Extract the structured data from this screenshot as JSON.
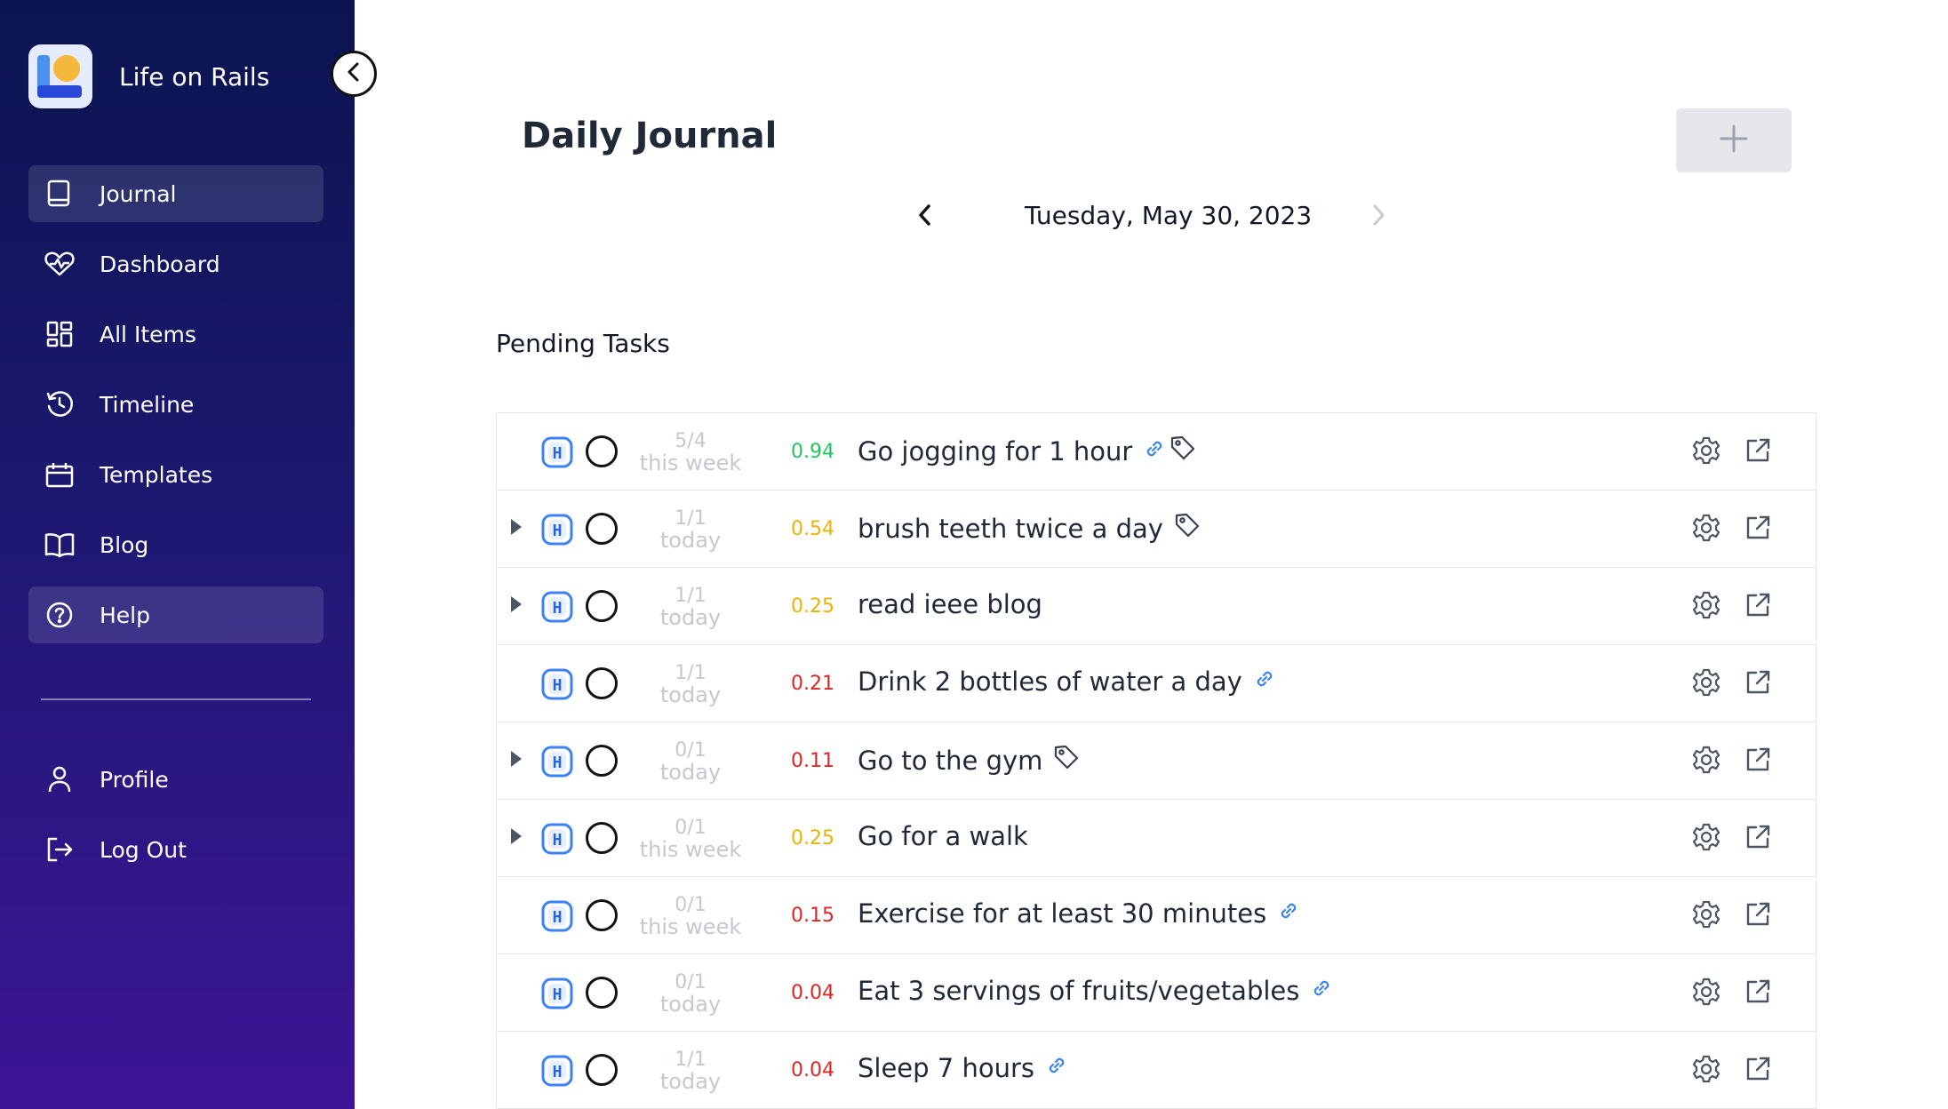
{
  "app": {
    "name": "Life on Rails"
  },
  "sidebar": {
    "items": [
      {
        "label": "Journal",
        "icon": "book-icon",
        "active": true
      },
      {
        "label": "Dashboard",
        "icon": "heart-pulse-icon"
      },
      {
        "label": "All Items",
        "icon": "grid-icon"
      },
      {
        "label": "Timeline",
        "icon": "history-icon"
      },
      {
        "label": "Templates",
        "icon": "calendar-icon"
      },
      {
        "label": "Blog",
        "icon": "open-book-icon"
      },
      {
        "label": "Help",
        "icon": "help-circle-icon",
        "active": true
      }
    ],
    "bottom_items": [
      {
        "label": "Profile",
        "icon": "user-icon"
      },
      {
        "label": "Log Out",
        "icon": "logout-icon"
      }
    ]
  },
  "page": {
    "title": "Daily Journal",
    "add_label": "+"
  },
  "date_nav": {
    "date": "Tuesday, May 30, 2023"
  },
  "pending": {
    "title": "Pending Tasks"
  },
  "tasks": [
    {
      "progress": "5/4",
      "period": "this week",
      "score": "0.94",
      "score_color": "#22c55e",
      "title": "Go jogging for 1 hour",
      "expandable": false,
      "link": true,
      "tag": true
    },
    {
      "progress": "1/1",
      "period": "today",
      "score": "0.54",
      "score_color": "#eab308",
      "title": "brush teeth twice a day",
      "expandable": true,
      "link": false,
      "tag": true
    },
    {
      "progress": "1/1",
      "period": "today",
      "score": "0.25",
      "score_color": "#eab308",
      "title": "read ieee blog",
      "expandable": true,
      "link": false,
      "tag": false
    },
    {
      "progress": "1/1",
      "period": "today",
      "score": "0.21",
      "score_color": "#dc2626",
      "title": "Drink 2 bottles of water a day",
      "expandable": false,
      "link": true,
      "tag": false
    },
    {
      "progress": "0/1",
      "period": "today",
      "score": "0.11",
      "score_color": "#dc2626",
      "title": "Go to the gym",
      "expandable": true,
      "link": false,
      "tag": true
    },
    {
      "progress": "0/1",
      "period": "this week",
      "score": "0.25",
      "score_color": "#eab308",
      "title": "Go for a walk",
      "expandable": true,
      "link": false,
      "tag": false
    },
    {
      "progress": "0/1",
      "period": "this week",
      "score": "0.15",
      "score_color": "#dc2626",
      "title": "Exercise for at least 30 minutes",
      "expandable": false,
      "link": true,
      "tag": false
    },
    {
      "progress": "0/1",
      "period": "today",
      "score": "0.04",
      "score_color": "#dc2626",
      "title": "Eat 3 servings of fruits/vegetables",
      "expandable": false,
      "link": true,
      "tag": false
    },
    {
      "progress": "1/1",
      "period": "today",
      "score": "0.04",
      "score_color": "#dc2626",
      "title": "Sleep 7 hours",
      "expandable": false,
      "link": true,
      "tag": false
    }
  ]
}
